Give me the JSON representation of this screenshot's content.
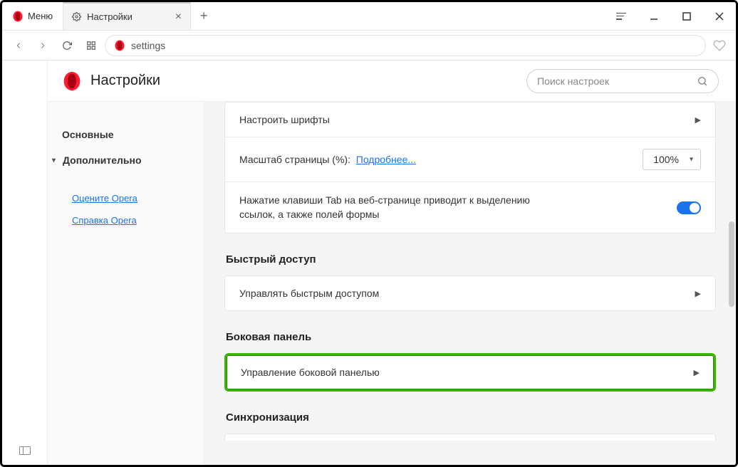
{
  "titlebar": {
    "menu_label": "Меню",
    "tab_label": "Настройки"
  },
  "addressbar": {
    "url": "settings"
  },
  "settings_header": {
    "title": "Настройки",
    "search_placeholder": "Поиск настроек"
  },
  "sidebar": {
    "basic": "Основные",
    "advanced": "Дополнительно",
    "rate_link": "Оцените Opera",
    "help_link": "Справка Opera"
  },
  "main": {
    "row_fonts": "Настроить шрифты",
    "row_zoom_label": "Масштаб страницы (%):",
    "row_zoom_more": "Подробнее...",
    "zoom_value": "100%",
    "row_tab_text": "Нажатие клавиши Tab на веб-странице приводит к выделению ссылок, а также полей формы",
    "section_quick": "Быстрый доступ",
    "row_quick": "Управлять быстрым доступом",
    "section_side": "Боковая панель",
    "row_side": "Управление боковой панелью",
    "section_sync": "Синхронизация"
  }
}
